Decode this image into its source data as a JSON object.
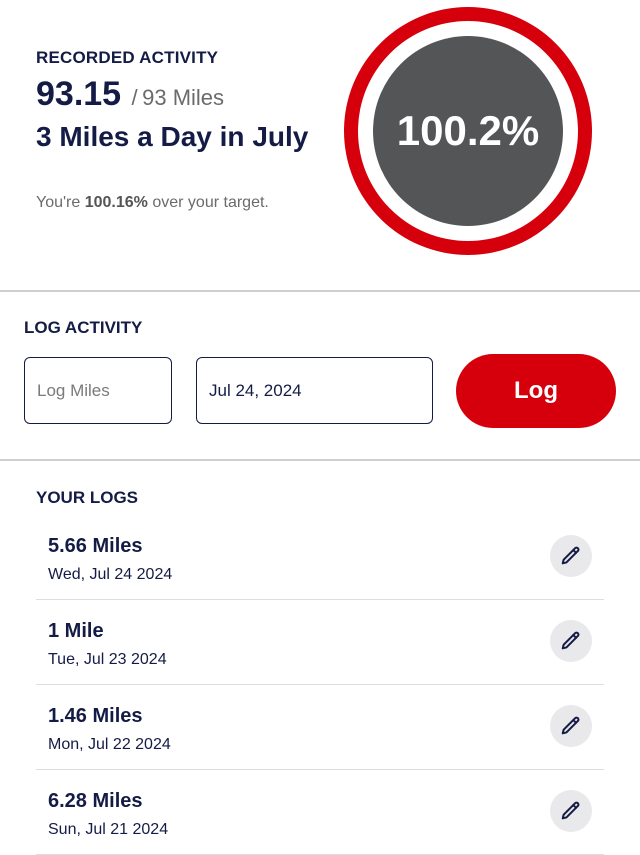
{
  "summary": {
    "label": "RECORDED ACTIVITY",
    "count": "93.15",
    "separator": "/",
    "target": "93 Miles",
    "goal_title": "3 Miles a Day in July",
    "over_prefix": "You're",
    "over_percent": "100.16%",
    "over_suffix": "over your target.",
    "progress_text": "100.2%",
    "progress_value": 1.0016
  },
  "log_activity": {
    "label": "LOG ACTIVITY",
    "miles_placeholder": "Log Miles",
    "date_value": "Jul 24, 2024",
    "button_label": "Log"
  },
  "your_logs": {
    "label": "YOUR LOGS",
    "entries": [
      {
        "miles": "5.66 Miles",
        "date": "Wed, Jul 24 2024"
      },
      {
        "miles": "1 Mile",
        "date": "Tue, Jul 23 2024"
      },
      {
        "miles": "1.46 Miles",
        "date": "Mon, Jul 22 2024"
      },
      {
        "miles": "6.28 Miles",
        "date": "Sun, Jul 21 2024"
      }
    ],
    "edit_icon": "pencil-icon"
  },
  "colors": {
    "accent": "#d6000c",
    "ring_core": "#535556",
    "text_dark": "#141b45",
    "text_muted": "#6b6b6b"
  }
}
